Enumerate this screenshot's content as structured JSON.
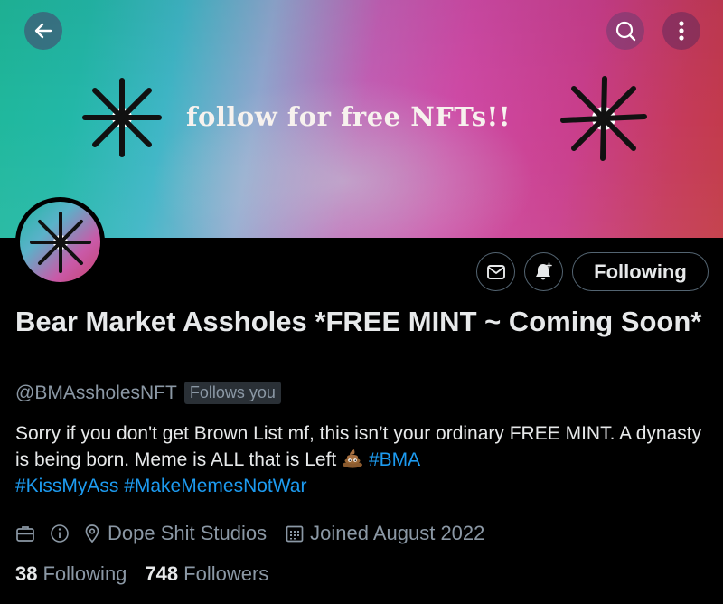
{
  "banner": {
    "text": "follow for free NFTs!!"
  },
  "header": {
    "back_icon": "arrow-left-icon",
    "search_icon": "search-icon",
    "more_icon": "more-vertical-icon"
  },
  "actions": {
    "message_icon": "envelope-icon",
    "notify_icon": "bell-plus-icon",
    "following_label": "Following"
  },
  "profile": {
    "display_name": "Bear Market Assholes *FREE MINT ~ Coming Soon*",
    "handle": "@BMAssholesNFT",
    "follows_you": "Follows you",
    "bio_text": "Sorry if you don't get Brown List mf, this isn’t your ordinary FREE MINT. A dynasty is being born. Meme is ALL that is Left",
    "bio_emoji": "pile-of-poo-emoji",
    "hashtags": [
      "#BMA",
      "#KissMyAss",
      "#MakeMemesNotWar"
    ],
    "category_icon": "briefcase-icon",
    "info_icon": "info-icon",
    "location_icon": "location-pin-icon",
    "location": "Dope Shit Studios",
    "calendar_icon": "calendar-icon",
    "joined": "Joined August 2022"
  },
  "stats": {
    "following_count": "38",
    "following_label": "Following",
    "followers_count": "748",
    "followers_label": "Followers"
  },
  "colors": {
    "link": "#1d9bf0",
    "secondary_text": "#8b98a5",
    "primary_text": "#e7e9ea",
    "background": "#000000"
  }
}
